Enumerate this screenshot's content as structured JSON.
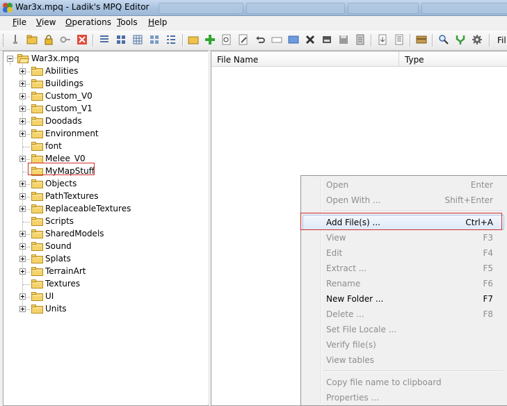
{
  "window": {
    "title": "War3x.mpq - Ladik's MPQ Editor"
  },
  "menubar": [
    {
      "first": "F",
      "rest": "ile"
    },
    {
      "first": "V",
      "rest": "iew"
    },
    {
      "first": "O",
      "rest": "perations"
    },
    {
      "first": "T",
      "rest": "ools"
    },
    {
      "first": "H",
      "rest": "elp"
    }
  ],
  "toolbar": {
    "trailing_label": "Fil"
  },
  "tree": {
    "root": "War3x.mpq",
    "folders": [
      {
        "label": "Abilities",
        "expandable": true
      },
      {
        "label": "Buildings",
        "expandable": true
      },
      {
        "label": "Custom_V0",
        "expandable": true
      },
      {
        "label": "Custom_V1",
        "expandable": true
      },
      {
        "label": "Doodads",
        "expandable": true
      },
      {
        "label": "Environment",
        "expandable": true
      },
      {
        "label": "font",
        "expandable": false
      },
      {
        "label": "Melee_V0",
        "expandable": true
      },
      {
        "label": "MyMapStuff",
        "expandable": false,
        "selected": true
      },
      {
        "label": "Objects",
        "expandable": true
      },
      {
        "label": "PathTextures",
        "expandable": true
      },
      {
        "label": "ReplaceableTextures",
        "expandable": true
      },
      {
        "label": "Scripts",
        "expandable": false
      },
      {
        "label": "SharedModels",
        "expandable": true
      },
      {
        "label": "Sound",
        "expandable": true
      },
      {
        "label": "Splats",
        "expandable": true
      },
      {
        "label": "TerrainArt",
        "expandable": true
      },
      {
        "label": "Textures",
        "expandable": false
      },
      {
        "label": "UI",
        "expandable": true
      },
      {
        "label": "Units",
        "expandable": true
      }
    ]
  },
  "list": {
    "columns": [
      "File Name",
      "Type"
    ]
  },
  "context_menu": {
    "groups": [
      [
        {
          "label": "Open",
          "shortcut": "Enter",
          "enabled": false
        },
        {
          "label": "Open With ...",
          "shortcut": "Shift+Enter",
          "enabled": false
        }
      ],
      [
        {
          "label": "Add File(s) ...",
          "shortcut": "Ctrl+A",
          "enabled": true,
          "highlighted": true
        },
        {
          "label": "View",
          "shortcut": "F3",
          "enabled": false
        },
        {
          "label": "Edit",
          "shortcut": "F4",
          "enabled": false
        },
        {
          "label": "Extract ...",
          "shortcut": "F5",
          "enabled": false
        },
        {
          "label": "Rename",
          "shortcut": "F6",
          "enabled": false
        },
        {
          "label": "New Folder ...",
          "shortcut": "F7",
          "enabled": true
        },
        {
          "label": "Delete ...",
          "shortcut": "F8",
          "enabled": false
        },
        {
          "label": "Set File Locale ...",
          "shortcut": "",
          "enabled": false
        },
        {
          "label": "Verify file(s)",
          "shortcut": "",
          "enabled": false
        },
        {
          "label": "View tables",
          "shortcut": "",
          "enabled": false
        }
      ],
      [
        {
          "label": "Copy file name to clipboard",
          "shortcut": "",
          "enabled": false
        },
        {
          "label": "Properties ...",
          "shortcut": "",
          "enabled": false
        }
      ]
    ]
  },
  "colors": {
    "annotation_red": "#d42a2a",
    "folder_yellow": "#f5d36b",
    "hover_blue": "#a8c7ee"
  }
}
